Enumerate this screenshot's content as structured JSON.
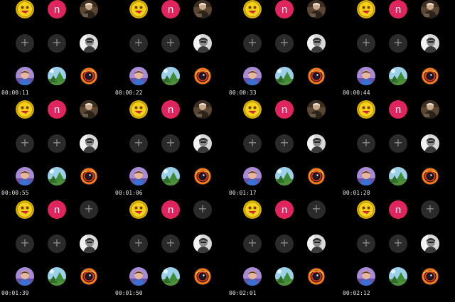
{
  "title": "",
  "add_label": "+",
  "icons": {
    "emoji-avatar": {
      "name": "smiley-emoji-icon",
      "label": ""
    },
    "letter-avatar": {
      "name": "letter-avatar-icon",
      "label": "n"
    },
    "person-old-photo": {
      "name": "person-photo-icon",
      "label": ""
    },
    "person-bw-portrait": {
      "name": "bw-portrait-icon",
      "label": ""
    },
    "person-color-avatar": {
      "name": "person-avatar-icon",
      "label": ""
    },
    "tree-landscape": {
      "name": "tree-landscape-icon",
      "label": ""
    },
    "eye-swirl": {
      "name": "eye-swirl-icon",
      "label": ""
    }
  },
  "colors": {
    "background": "#000000",
    "add_tile": "#2a2a2a",
    "add_glyph": "#8a8a8a",
    "letter_avatar": "#e0245e",
    "timestamp": "#e6e6e6"
  },
  "frames": [
    {
      "timestamp": "00:00:11",
      "slots": [
        "emoji-avatar",
        "letter-avatar",
        "person-old-photo",
        "add",
        "add",
        "person-bw-portrait",
        "person-color-avatar",
        "tree-landscape",
        "eye-swirl"
      ]
    },
    {
      "timestamp": "00:00:22",
      "slots": [
        "emoji-avatar",
        "letter-avatar",
        "person-old-photo",
        "add",
        "add",
        "person-bw-portrait",
        "person-color-avatar",
        "tree-landscape",
        "eye-swirl"
      ]
    },
    {
      "timestamp": "00:00:33",
      "slots": [
        "emoji-avatar",
        "letter-avatar",
        "person-old-photo",
        "add",
        "add",
        "person-bw-portrait",
        "person-color-avatar",
        "tree-landscape",
        "eye-swirl"
      ]
    },
    {
      "timestamp": "00:00:44",
      "slots": [
        "emoji-avatar",
        "letter-avatar",
        "person-old-photo",
        "add",
        "add",
        "person-bw-portrait",
        "person-color-avatar",
        "tree-landscape",
        "eye-swirl"
      ]
    },
    {
      "timestamp": "00:00:55",
      "slots": [
        "emoji-avatar",
        "letter-avatar",
        "person-old-photo",
        "add",
        "add",
        "person-bw-portrait",
        "person-color-avatar",
        "tree-landscape",
        "eye-swirl"
      ]
    },
    {
      "timestamp": "00:01:06",
      "slots": [
        "emoji-avatar",
        "letter-avatar",
        "person-old-photo",
        "add",
        "add",
        "person-bw-portrait",
        "person-color-avatar",
        "tree-landscape",
        "eye-swirl"
      ]
    },
    {
      "timestamp": "00:01:17",
      "slots": [
        "emoji-avatar",
        "letter-avatar",
        "person-old-photo",
        "add",
        "add",
        "person-bw-portrait",
        "person-color-avatar",
        "tree-landscape",
        "eye-swirl"
      ]
    },
    {
      "timestamp": "00:01:28",
      "slots": [
        "emoji-avatar",
        "letter-avatar",
        "person-old-photo",
        "add",
        "add",
        "person-bw-portrait",
        "person-color-avatar",
        "tree-landscape",
        "eye-swirl"
      ]
    },
    {
      "timestamp": "00:01:39",
      "slots": [
        "emoji-avatar",
        "letter-avatar",
        "add",
        "add",
        "add",
        "person-bw-portrait",
        "person-color-avatar",
        "tree-landscape",
        "eye-swirl"
      ]
    },
    {
      "timestamp": "00:01:50",
      "slots": [
        "emoji-avatar",
        "letter-avatar",
        "add",
        "add",
        "add",
        "person-bw-portrait",
        "person-color-avatar",
        "tree-landscape",
        "eye-swirl"
      ]
    },
    {
      "timestamp": "00:02:01",
      "slots": [
        "emoji-avatar",
        "letter-avatar",
        "add",
        "add",
        "add",
        "person-bw-portrait",
        "person-color-avatar",
        "tree-landscape",
        "eye-swirl"
      ]
    },
    {
      "timestamp": "00:02:12",
      "slots": [
        "emoji-avatar",
        "letter-avatar",
        "add",
        "add",
        "add",
        "person-bw-portrait",
        "person-color-avatar",
        "tree-landscape",
        "eye-swirl"
      ]
    }
  ]
}
